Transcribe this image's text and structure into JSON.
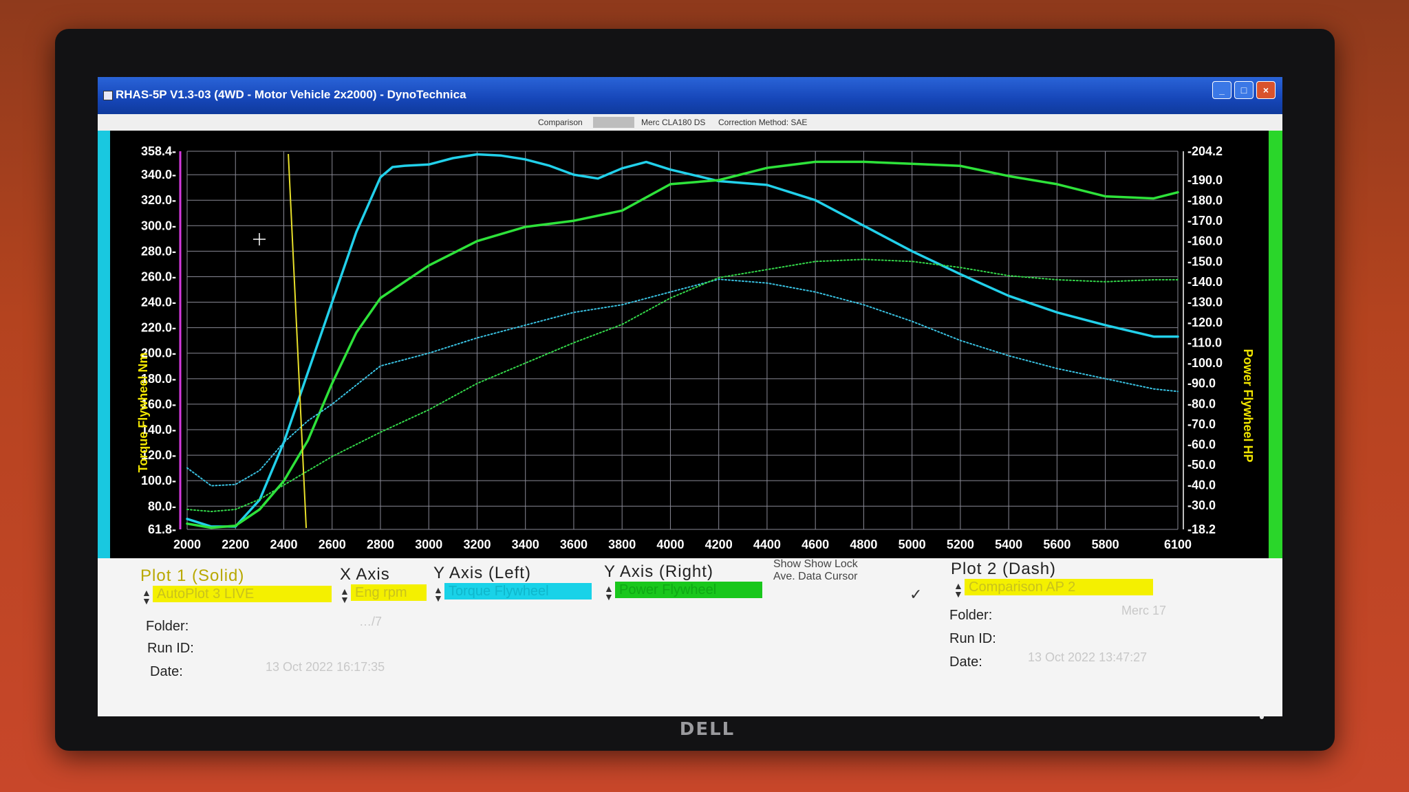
{
  "window": {
    "title": "RHAS-5P V1.3-03  (4WD - Motor Vehicle 2x2000) - DynoTechnica",
    "buttons": {
      "minimize": "_",
      "maximize": "□",
      "close": "×"
    }
  },
  "infobar": {
    "comparison_label": "Comparison",
    "vehicle": "Merc CLA180 DS",
    "correction": "Correction Method: SAE"
  },
  "chart_data": {
    "type": "line",
    "xlabel": "",
    "ylabel_left": "Torque Flywheel Nm",
    "ylabel_right": "Power Flywheel HP",
    "xlim": [
      2000,
      6100
    ],
    "ylim_left": [
      61.8,
      358.4
    ],
    "ylim_right": [
      18.2,
      204.2
    ],
    "x_ticks": [
      "2000",
      "2200",
      "2400",
      "2600",
      "2800",
      "3000",
      "3200",
      "3400",
      "3600",
      "3800",
      "4000",
      "4200",
      "4400",
      "4600",
      "4800",
      "5000",
      "5200",
      "5400",
      "5600",
      "5800",
      "6100"
    ],
    "y_left_ticks": [
      "358.4",
      "340.0",
      "320.0",
      "300.0",
      "280.0",
      "260.0",
      "240.0",
      "220.0",
      "200.0",
      "180.0",
      "160.0",
      "140.0",
      "120.0",
      "100.0",
      "80.0",
      "61.8"
    ],
    "y_right_ticks": [
      "204.2",
      "190.0",
      "180.0",
      "170.0",
      "160.0",
      "150.0",
      "140.0",
      "130.0",
      "120.0",
      "110.0",
      "100.0",
      "90.0",
      "80.0",
      "70.0",
      "60.0",
      "50.0",
      "40.0",
      "30.0",
      "18.2"
    ],
    "cursor_rpm": 2470,
    "grid": true,
    "series": [
      {
        "axis": "left",
        "style": "solid",
        "color": "#22d0ea",
        "x": [
          2000,
          2100,
          2200,
          2300,
          2400,
          2500,
          2600,
          2700,
          2800,
          2850,
          2900,
          3000,
          3100,
          3200,
          3300,
          3400,
          3500,
          3600,
          3700,
          3800,
          3900,
          4000,
          4200,
          4400,
          4600,
          4800,
          5000,
          5200,
          5400,
          5600,
          5800,
          6000,
          6100
        ],
        "y": [
          70,
          64,
          64,
          85,
          130,
          185,
          240,
          295,
          338,
          346,
          347,
          348,
          353,
          356,
          355,
          352,
          347,
          340,
          337,
          345,
          350,
          344,
          335,
          332,
          320,
          300,
          280,
          262,
          245,
          232,
          222,
          213,
          213
        ]
      },
      {
        "axis": "right",
        "style": "solid",
        "color": "#2ee23a",
        "x": [
          2000,
          2100,
          2200,
          2300,
          2400,
          2500,
          2600,
          2700,
          2800,
          2900,
          3000,
          3200,
          3400,
          3600,
          3800,
          4000,
          4200,
          4400,
          4600,
          4800,
          5000,
          5200,
          5400,
          5600,
          5800,
          6000,
          6100
        ],
        "y": [
          21,
          19,
          20,
          28,
          42,
          62,
          90,
          115,
          132,
          140,
          148,
          160,
          167,
          170,
          175,
          188,
          190,
          196,
          199,
          199,
          198,
          197,
          192,
          188,
          182,
          181,
          184
        ]
      },
      {
        "axis": "left",
        "style": "dash",
        "color": "#39c2e2",
        "x": [
          2000,
          2100,
          2200,
          2300,
          2400,
          2500,
          2600,
          2800,
          3000,
          3200,
          3400,
          3600,
          3800,
          4000,
          4200,
          4400,
          4600,
          4800,
          5000,
          5200,
          5400,
          5600,
          5800,
          6000,
          6100
        ],
        "y": [
          110,
          96,
          97,
          108,
          130,
          147,
          160,
          190,
          200,
          212,
          222,
          232,
          238,
          248,
          258,
          255,
          248,
          238,
          225,
          210,
          198,
          188,
          180,
          172,
          170
        ]
      },
      {
        "axis": "right",
        "style": "dash",
        "color": "#33d84a",
        "x": [
          2000,
          2100,
          2200,
          2300,
          2400,
          2500,
          2600,
          2800,
          3000,
          3200,
          3400,
          3600,
          3800,
          4000,
          4200,
          4400,
          4600,
          4800,
          5000,
          5200,
          5400,
          5600,
          5800,
          6000,
          6100
        ],
        "y": [
          28,
          27,
          28,
          33,
          40,
          47,
          54,
          66,
          77,
          90,
          100,
          110,
          119,
          132,
          142,
          146,
          150,
          151,
          150,
          147,
          143,
          141,
          140,
          141,
          141
        ]
      }
    ]
  },
  "panel": {
    "plot1": {
      "header": "Plot 1 (Solid)",
      "value": "AutoPlot 3 LIVE"
    },
    "xaxis": {
      "header": "X Axis",
      "value": "Eng rpm"
    },
    "yleft": {
      "header": "Y Axis (Left)",
      "value": "Torque Flywheel"
    },
    "yright": {
      "header": "Y Axis (Right)",
      "value": "Power Flywheel"
    },
    "toggles": {
      "line1": "Show Show Lock",
      "line2": "Ave.   Data Cursor",
      "check": "✓"
    },
    "plot2": {
      "header": "Plot 2 (Dash)",
      "value": "Comparison AP 2"
    },
    "left_info": {
      "folder_label": "Folder:",
      "folder_value": "…/7",
      "runid_label": "Run ID:",
      "date_label": "Date:",
      "date_value": "13 Oct 2022  16:17:35"
    },
    "right_info": {
      "folder_label": "Folder:",
      "folder_value": "Merc 17",
      "runid_label": "Run ID:",
      "date_label": "Date:",
      "date_value": "13 Oct 2022  13:47:27"
    }
  }
}
